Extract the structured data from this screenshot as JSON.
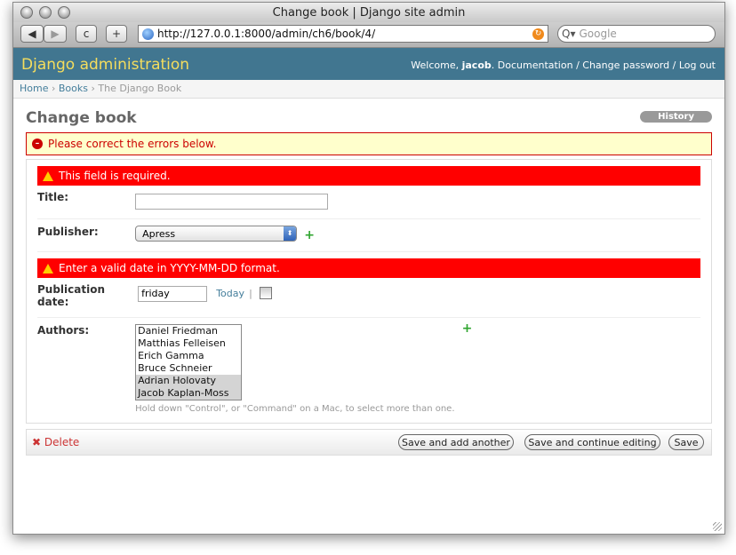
{
  "browser": {
    "window_title": "Change book | Django site admin",
    "url": "http://127.0.0.1:8000/admin/ch6/book/4/",
    "search_placeholder": "Google",
    "back": "◀",
    "forward": "▶",
    "reload": "c",
    "add_tab": "+"
  },
  "header": {
    "brand": "Django administration",
    "welcome": "Welcome, ",
    "user": "jacob",
    "links": [
      "Documentation",
      "Change password",
      "Log out"
    ]
  },
  "breadcrumbs": {
    "home": "Home",
    "books": "Books",
    "current": "The Django Book"
  },
  "page": {
    "title": "Change book",
    "history": "History"
  },
  "errornote": "Please correct the errors below.",
  "fields": {
    "title": {
      "label": "Title:",
      "error": "This field is required.",
      "value": ""
    },
    "publisher": {
      "label": "Publisher:",
      "selected": "Apress"
    },
    "pubdate": {
      "label_1": "Publication",
      "label_2": "date:",
      "error": "Enter a valid date in YYYY-MM-DD format.",
      "value": "friday",
      "today": "Today",
      "sep": "|"
    },
    "authors": {
      "label": "Authors:",
      "options": [
        "Daniel Friedman",
        "Matthias Felleisen",
        "Erich Gamma",
        "Bruce Schneier",
        "Adrian Holovaty",
        "Jacob Kaplan-Moss"
      ],
      "help": "Hold down \"Control\", or \"Command\" on a Mac, to select more than one."
    }
  },
  "submit": {
    "delete": "Delete",
    "save_add": "Save and add another",
    "save_continue": "Save and continue editing",
    "save": "Save"
  },
  "colors": {
    "header": "#417690",
    "brand": "#f5dd5d",
    "error": "#ff0000"
  }
}
